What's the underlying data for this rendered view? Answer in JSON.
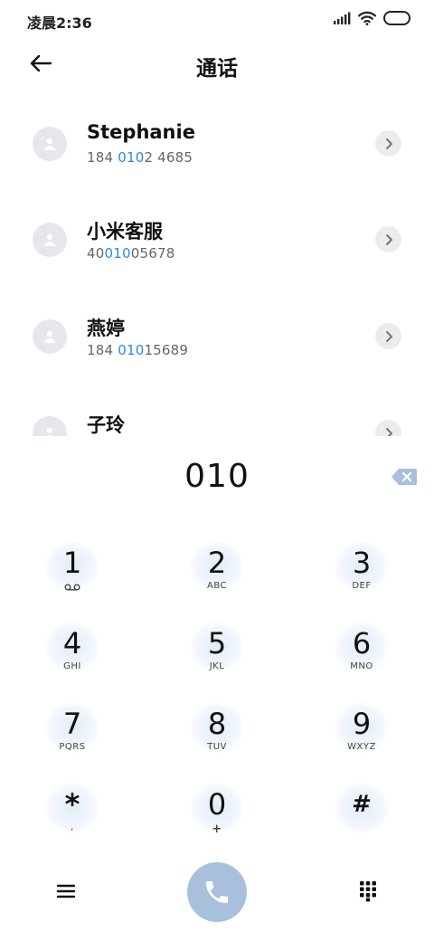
{
  "status_bar": {
    "time": "凌晨2:36",
    "icons": [
      "signal-icon",
      "wifi-icon",
      "battery-icon"
    ]
  },
  "header": {
    "title": "通话",
    "back_icon": "back-arrow-icon"
  },
  "contacts": [
    {
      "name": "Stephanie",
      "number_parts": [
        "184 ",
        "010",
        "2 4685"
      ]
    },
    {
      "name": "小米客服",
      "number_parts": [
        "40",
        "010",
        "05678"
      ]
    },
    {
      "name": "燕婷",
      "number_parts": [
        "184 ",
        "010",
        "15689"
      ]
    },
    {
      "name": "子玲",
      "number_parts": [
        "",
        "",
        ""
      ]
    }
  ],
  "dial": {
    "number": "010",
    "backspace_icon": "backspace-icon"
  },
  "keypad": [
    {
      "digit": "1",
      "letters": "",
      "sub_icon": "voicemail-icon"
    },
    {
      "digit": "2",
      "letters": "ABC"
    },
    {
      "digit": "3",
      "letters": "DEF"
    },
    {
      "digit": "4",
      "letters": "GHI"
    },
    {
      "digit": "5",
      "letters": "JKL"
    },
    {
      "digit": "6",
      "letters": "MNO"
    },
    {
      "digit": "7",
      "letters": "PQRS"
    },
    {
      "digit": "8",
      "letters": "TUV"
    },
    {
      "digit": "9",
      "letters": "WXYZ"
    },
    {
      "digit": "*",
      "letters": ","
    },
    {
      "digit": "0",
      "letters": "+"
    },
    {
      "digit": "#",
      "letters": ""
    }
  ],
  "bottom_bar": {
    "menu_icon": "menu-icon",
    "call_icon": "phone-icon",
    "keypad_icon": "dialpad-icon",
    "call_button_color": "#a8c0dc"
  },
  "colors": {
    "highlight": "#2a8ae0",
    "avatar_bg": "#e6e7ea"
  }
}
